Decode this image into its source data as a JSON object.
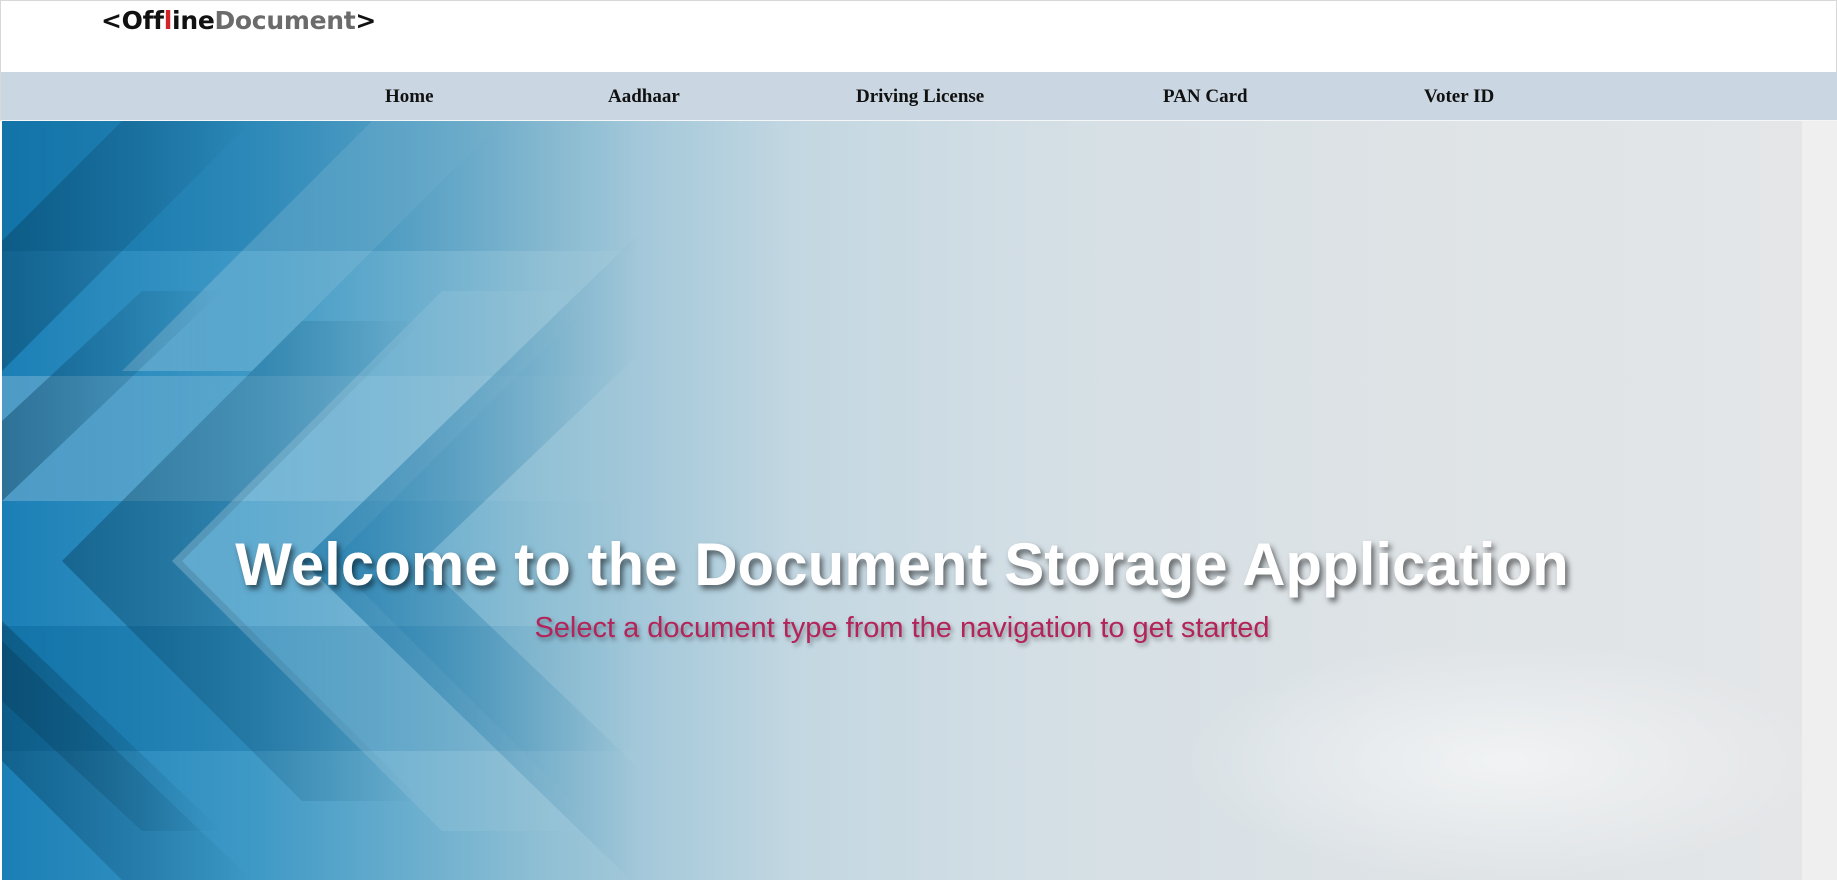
{
  "logo": {
    "part1": "<Off",
    "part2": "l",
    "part3": "ine",
    "part4": "Document",
    "part5": ">"
  },
  "nav": {
    "items": [
      {
        "label": "Home"
      },
      {
        "label": "Aadhaar"
      },
      {
        "label": "Driving License"
      },
      {
        "label": "PAN Card"
      },
      {
        "label": "Voter ID"
      }
    ]
  },
  "hero": {
    "title": "Welcome to the Document Storage Application",
    "subtitle": "Select a document type from the navigation to get started"
  },
  "colors": {
    "navbar_bg": "#cad7e2",
    "subtitle_text": "#b3245a",
    "logo_accent": "#d2232a",
    "logo_gray": "#6b6b6b"
  }
}
